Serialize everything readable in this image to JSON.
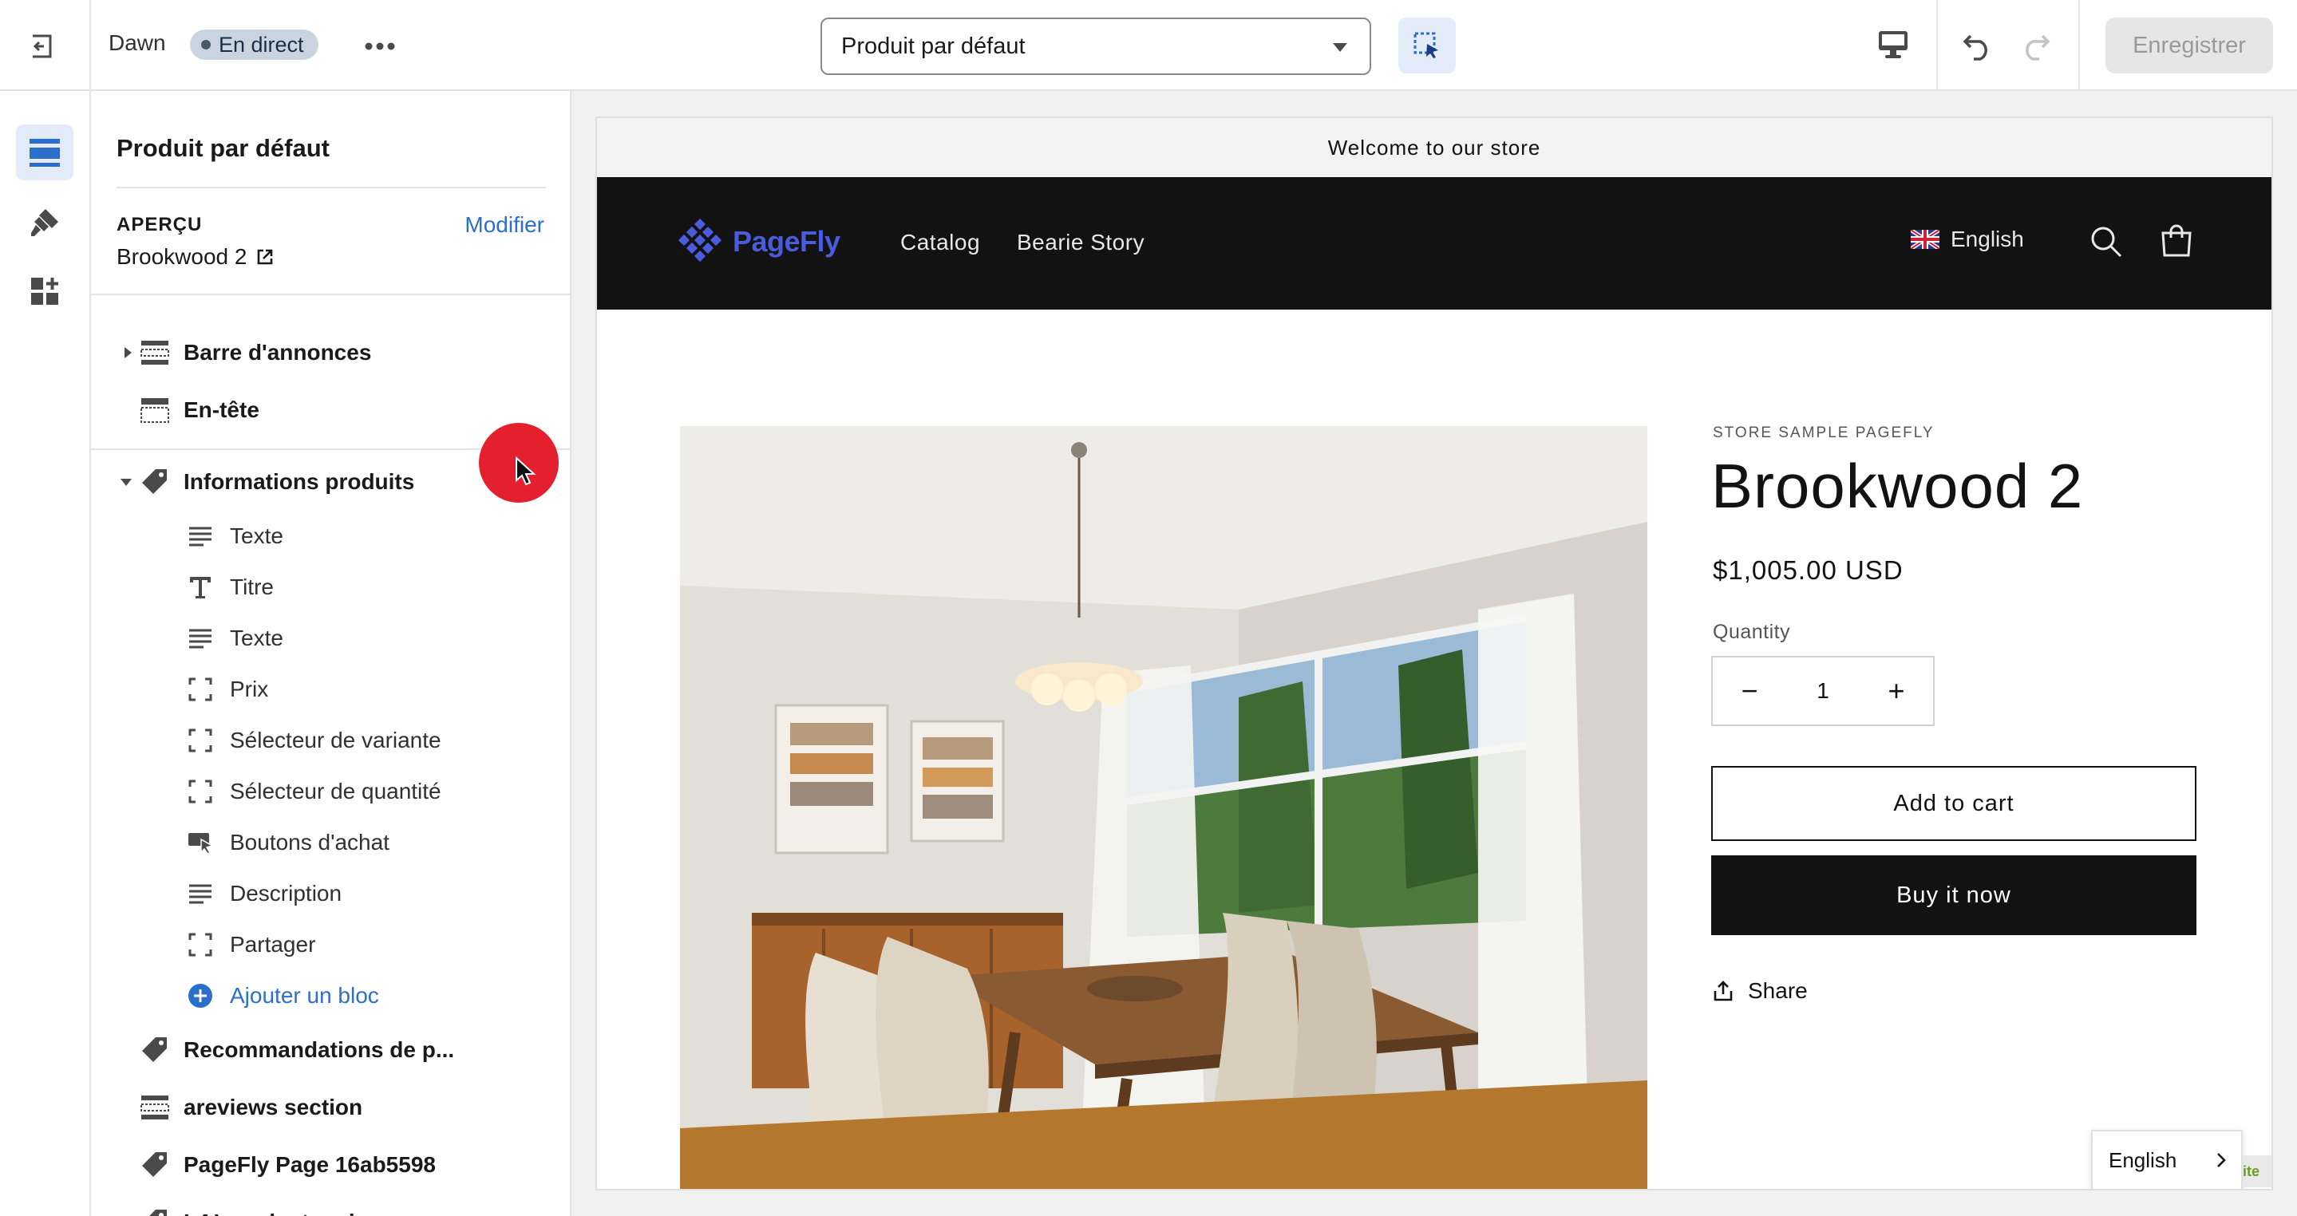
{
  "topbar": {
    "theme_name": "Dawn",
    "live_badge": "En direct",
    "template_select": "Produit par défaut",
    "save_label": "Enregistrer"
  },
  "sidebar": {
    "title": "Produit par défaut",
    "preview_label": "APERÇU",
    "preview_modify": "Modifier",
    "preview_product": "Brookwood 2",
    "sections": [
      {
        "label": "Barre d'annonces",
        "icon": "section-bar-icon"
      },
      {
        "label": "En-tête",
        "icon": "header-section-icon"
      },
      {
        "label": "Informations produits",
        "icon": "tag-icon"
      },
      {
        "label": "Recommandations de p...",
        "icon": "tag-icon"
      },
      {
        "label": "areviews section",
        "icon": "section-bar-icon"
      },
      {
        "label": "PageFly Page 16ab5598",
        "icon": "tag-icon"
      },
      {
        "label": "LAI product reviews",
        "icon": "tag-icon"
      }
    ],
    "blocks": [
      {
        "label": "Texte",
        "icon": "text-lines-icon"
      },
      {
        "label": "Titre",
        "icon": "title-t-icon"
      },
      {
        "label": "Texte",
        "icon": "text-lines-icon"
      },
      {
        "label": "Prix",
        "icon": "dashed-frame-icon"
      },
      {
        "label": "Sélecteur de variante",
        "icon": "dashed-frame-icon"
      },
      {
        "label": "Sélecteur de quantité",
        "icon": "dashed-frame-icon"
      },
      {
        "label": "Boutons d'achat",
        "icon": "buy-buttons-icon"
      },
      {
        "label": "Description",
        "icon": "text-lines-icon"
      },
      {
        "label": "Partager",
        "icon": "dashed-frame-icon"
      }
    ],
    "add_block": "Ajouter un bloc"
  },
  "store": {
    "announcement": "Welcome to our store",
    "logo_text": "PageFly",
    "nav": [
      "Catalog",
      "Bearie Story"
    ],
    "language": "English",
    "product": {
      "vendor": "STORE SAMPLE PAGEFLY",
      "title": "Brookwood 2",
      "price": "$1,005.00 USD",
      "quantity_label": "Quantity",
      "quantity_value": "1",
      "add_to_cart": "Add to cart",
      "buy_now": "Buy it now",
      "share": "Share"
    },
    "language_popup": "English",
    "corner_badge": "ite"
  },
  "colors": {
    "accent": "#2c6ecb",
    "header_bg": "#121212",
    "logo": "#4a5bdc",
    "cursor_dot": "#e5202e"
  }
}
